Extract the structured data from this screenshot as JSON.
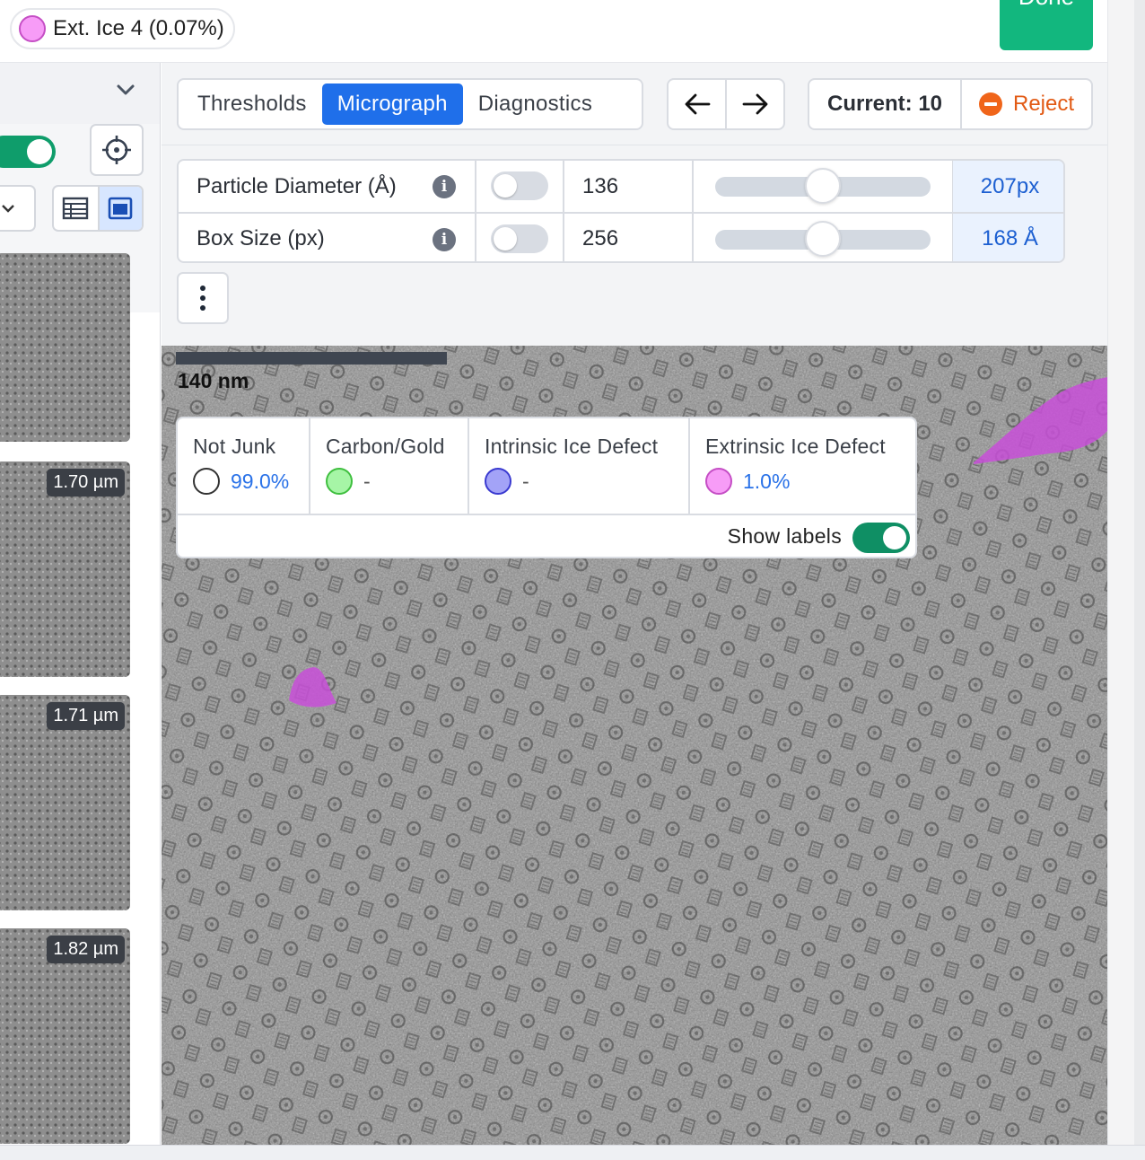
{
  "topbar": {
    "active_class_chip": "Ext. Ice 4 (0.07%)",
    "active_class_color": "#f79cf7",
    "done_label": "Done"
  },
  "left_panel": {
    "collapse_icon": "chevron-down-icon",
    "thumbnails": [
      {
        "defocus": ""
      },
      {
        "defocus": "1.70 µm"
      },
      {
        "defocus": "1.71 µm"
      },
      {
        "defocus": "1.82 µm"
      }
    ]
  },
  "tabs": [
    {
      "label": "Thresholds",
      "active": false
    },
    {
      "label": "Micrograph",
      "active": true
    },
    {
      "label": "Diagnostics",
      "active": false
    }
  ],
  "nav": {
    "current_label": "Current: 10",
    "reject_label": "Reject"
  },
  "params": [
    {
      "label": "Particle Diameter (Å)",
      "value": "136",
      "slider_fraction": 0.5,
      "converted": "207px"
    },
    {
      "label": "Box Size (px)",
      "value": "256",
      "slider_fraction": 0.5,
      "converted": "168 Å"
    }
  ],
  "micrograph": {
    "scale_label": "140 nm",
    "legend": [
      {
        "name": "Not Junk",
        "value": "99.0%",
        "color": "#ffffff"
      },
      {
        "name": "Carbon/Gold",
        "value": "-",
        "color": "#a6f5a6"
      },
      {
        "name": "Intrinsic Ice Defect",
        "value": "-",
        "color": "#a3a3f7"
      },
      {
        "name": "Extrinsic Ice Defect",
        "value": "1.0%",
        "color": "#f79cf7"
      }
    ],
    "show_labels_text": "Show labels",
    "show_labels_on": true
  },
  "colors": {
    "accent": "#1f6fea",
    "success": "#12b77e",
    "reject": "#e25a14",
    "junk_overlay": "#c84fd8"
  }
}
